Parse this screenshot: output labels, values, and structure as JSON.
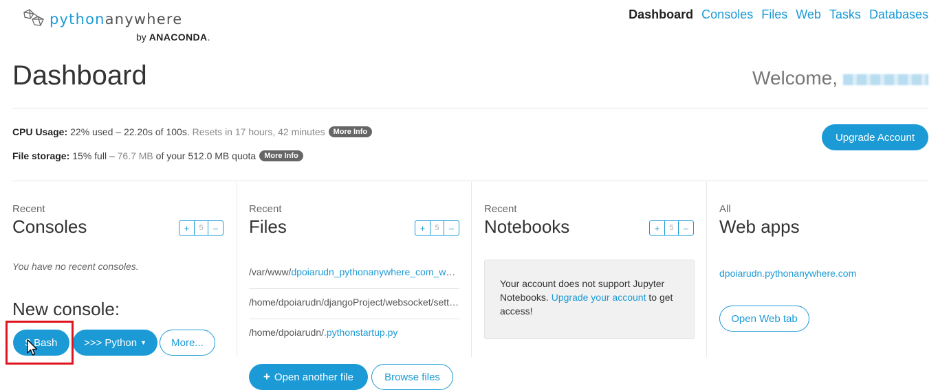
{
  "brand": {
    "name_prefix": "python",
    "name_suffix": "anywhere",
    "by_text": "by",
    "company": "ANACONDA",
    "company_dot": "."
  },
  "nav": {
    "items": [
      "Dashboard",
      "Consoles",
      "Files",
      "Web",
      "Tasks",
      "Databases"
    ],
    "active": "Dashboard"
  },
  "page": {
    "title": "Dashboard",
    "welcome": "Welcome,"
  },
  "usage": {
    "cpu": {
      "label": "CPU Usage:",
      "text": "22% used – 22.20s of 100s.",
      "resets": "Resets in 17 hours, 42 minutes",
      "more": "More Info"
    },
    "storage": {
      "label": "File storage:",
      "prefix": "15% full –",
      "used": "76.7 MB",
      "suffix": "of your 512.0 MB quota",
      "more": "More Info"
    },
    "upgrade_button": "Upgrade Account"
  },
  "stepper": {
    "plus": "+",
    "value": "5",
    "minus": "–"
  },
  "consoles": {
    "kicker": "Recent",
    "title": "Consoles",
    "empty": "You have no recent consoles.",
    "new_console": "New console:",
    "bash_button": "$ Bash",
    "python_button": ">>> Python",
    "more_button": "More..."
  },
  "files": {
    "kicker": "Recent",
    "title": "Files",
    "items": [
      {
        "prefix": "/var/www/",
        "link": "dpoiarudn_pythonanywhere_com_wsgi.py"
      },
      {
        "prefix": "/home/dpoiarudn/djangoProject/websocket/settings.py",
        "link": ""
      },
      {
        "prefix": "/home/dpoiarudn/",
        "link": ".pythonstartup.py"
      }
    ],
    "open_button": "Open another file",
    "browse_button": "Browse files"
  },
  "notebooks": {
    "kicker": "Recent",
    "title": "Notebooks",
    "message_start": "Your account does not support Jupyter Notebooks.",
    "message_link": "Upgrade your account",
    "message_end": "to get access!"
  },
  "webapps": {
    "kicker": "All",
    "title": "Web apps",
    "link": "dpoiarudn.pythonanywhere.com",
    "open_button": "Open Web tab"
  },
  "colors": {
    "accent": "#1b9ad6",
    "pill": "#666666",
    "highlight": "#e0141e"
  }
}
